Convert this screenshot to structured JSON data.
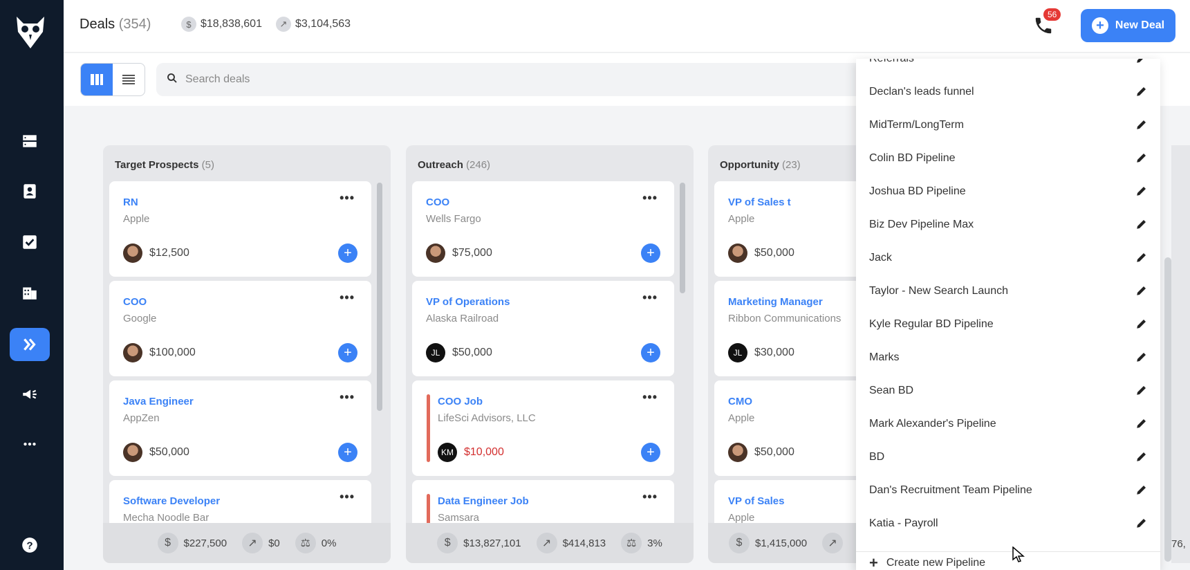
{
  "header": {
    "title": "Deals",
    "count": "(354)",
    "total_value": "$18,838,601",
    "weighted_value": "$3,104,563",
    "notifications": "56",
    "new_deal_label": "New Deal"
  },
  "toolbar": {
    "search_placeholder": "Search deals"
  },
  "columns": [
    {
      "name": "Target Prospects",
      "count": "(5)",
      "cards": [
        {
          "role": "RN",
          "company": "Apple",
          "amount": "$12,500"
        },
        {
          "role": "COO",
          "company": "Google",
          "amount": "$100,000"
        },
        {
          "role": "Java Engineer",
          "company": "AppZen",
          "amount": "$50,000"
        },
        {
          "role": "Software Developer",
          "company": "Mecha Noodle Bar",
          "amount": ""
        }
      ],
      "footer": {
        "total": "$227,500",
        "weighted": "$0",
        "ratio": "0%"
      }
    },
    {
      "name": "Outreach",
      "count": "(246)",
      "cards": [
        {
          "role": "COO",
          "company": "Wells Fargo",
          "amount": "$75,000"
        },
        {
          "role": "VP of Operations",
          "company": "Alaska Railroad",
          "amount": "$50,000",
          "initials": "JL"
        },
        {
          "role": "COO Job",
          "company": "LifeSci Advisors, LLC",
          "amount": "$10,000",
          "initials": "KM"
        },
        {
          "role": "Data Engineer Job",
          "company": "Samsara",
          "amount": ""
        }
      ],
      "footer": {
        "total": "$13,827,101",
        "weighted": "$414,813",
        "ratio": "3%"
      }
    },
    {
      "name": "Opportunity",
      "count": "(23)",
      "cards": [
        {
          "role": "VP of Sales t",
          "company": "Apple",
          "amount": "$50,000"
        },
        {
          "role": "Marketing Manager",
          "company": "Ribbon Communications",
          "amount": "$30,000",
          "initials": "JL"
        },
        {
          "role": "CMO",
          "company": "Apple",
          "amount": "$50,000"
        },
        {
          "role": "VP of Sales",
          "company": "Apple",
          "amount": ""
        }
      ],
      "footer": {
        "total": "$1,415,000"
      }
    }
  ],
  "edge_text": "76,",
  "pipelines": {
    "items": [
      "Referrals",
      "Declan's leads funnel",
      "MidTerm/LongTerm",
      "Colin BD Pipeline",
      "Joshua BD Pipeline",
      "Biz Dev Pipeline Max",
      "Jack",
      "Taylor - New Search Launch",
      "Kyle Regular BD Pipeline",
      "Marks",
      "Sean BD",
      "Mark Alexander's Pipeline",
      "BD",
      "Dan's Recruitment Team Pipeline",
      "Katia - Payroll"
    ],
    "create_label": "Create new Pipeline"
  },
  "colors": {
    "sidebar": "#0f1b2b",
    "accent": "#3b82f6",
    "danger": "#d32f2f"
  }
}
